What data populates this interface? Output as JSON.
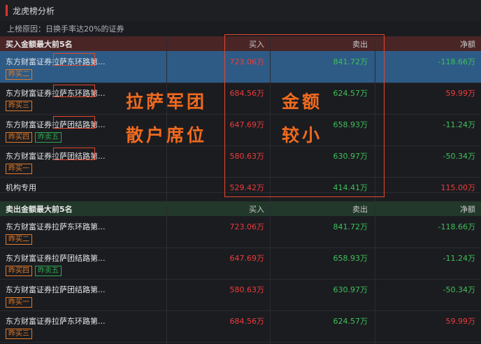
{
  "title": "龙虎榜分析",
  "reason": "上榜原因：日换手率达20%的证券",
  "colors": {
    "up": "#ee3b3b",
    "down": "#3fc05a",
    "annotation": "#f06a1e",
    "selected_row": "#2d5b86"
  },
  "buy_section": {
    "header": {
      "name": "买入金额最大前5名",
      "buy": "买入",
      "sell": "卖出",
      "net": "净额"
    },
    "rows": [
      {
        "name": "东方财富证券拉萨东环路第...",
        "tags": [
          {
            "label": "昨买二",
            "color": "orange"
          }
        ],
        "buy": "723.06万",
        "sell": "841.72万",
        "net": "-118.66万",
        "net_sign": "down",
        "selected": true
      },
      {
        "name": "东方财富证券拉萨东环路第...",
        "tags": [
          {
            "label": "昨买三",
            "color": "orange"
          }
        ],
        "buy": "684.56万",
        "sell": "624.57万",
        "net": "59.99万",
        "net_sign": "up"
      },
      {
        "name": "东方财富证券拉萨团结路第...",
        "tags": [
          {
            "label": "昨买四",
            "color": "orange"
          },
          {
            "label": "昨卖五",
            "color": "green"
          }
        ],
        "buy": "647.69万",
        "sell": "658.93万",
        "net": "-11.24万",
        "net_sign": "down"
      },
      {
        "name": "东方财富证券拉萨团结路第...",
        "tags": [
          {
            "label": "昨买一",
            "color": "orange"
          }
        ],
        "buy": "580.63万",
        "sell": "630.97万",
        "net": "-50.34万",
        "net_sign": "down"
      },
      {
        "name": "机构专用",
        "tags": [],
        "buy": "529.42万",
        "sell": "414.41万",
        "net": "115.00万",
        "net_sign": "up"
      }
    ]
  },
  "sell_section": {
    "header": {
      "name": "卖出金额最大前5名",
      "buy": "买入",
      "sell": "卖出",
      "net": "净额"
    },
    "rows": [
      {
        "name": "东方财富证券拉萨东环路第...",
        "tags": [
          {
            "label": "昨买二",
            "color": "orange"
          }
        ],
        "buy": "723.06万",
        "sell": "841.72万",
        "net": "-118.66万",
        "net_sign": "down"
      },
      {
        "name": "东方财富证券拉萨团结路第...",
        "tags": [
          {
            "label": "昨买四",
            "color": "orange"
          },
          {
            "label": "昨卖五",
            "color": "green"
          }
        ],
        "buy": "647.69万",
        "sell": "658.93万",
        "net": "-11.24万",
        "net_sign": "down"
      },
      {
        "name": "东方财富证券拉萨团结路第...",
        "tags": [
          {
            "label": "昨买一",
            "color": "orange"
          }
        ],
        "buy": "580.63万",
        "sell": "630.97万",
        "net": "-50.34万",
        "net_sign": "down"
      },
      {
        "name": "东方财富证券拉萨东环路第...",
        "tags": [
          {
            "label": "昨买三",
            "color": "orange"
          }
        ],
        "buy": "684.56万",
        "sell": "624.57万",
        "net": "59.99万",
        "net_sign": "up"
      }
    ]
  },
  "annotations": {
    "line1_left": "拉萨军团",
    "line2_left": "散户席位",
    "line1_right": "金额",
    "line2_right": "较小"
  }
}
